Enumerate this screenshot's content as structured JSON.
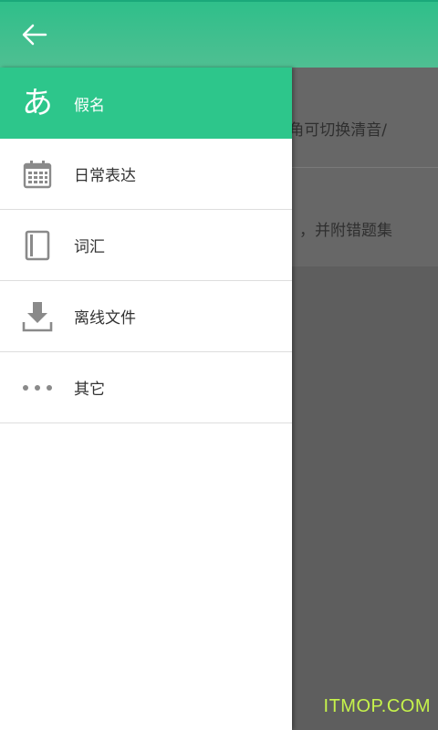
{
  "colors": {
    "accent": "#2dc68b",
    "topbar": "#4fbf92",
    "icon_gray": "#8a8a8a",
    "watermark": "#c6f34b"
  },
  "topbar": {
    "back_icon": "arrow-left-icon"
  },
  "background": {
    "line1": "角可切换清音/",
    "line2": "，并附错题集"
  },
  "drawer": {
    "items": [
      {
        "label": "假名",
        "icon": "あ",
        "icon_name": "kana-icon",
        "active": true
      },
      {
        "label": "日常表达",
        "icon_name": "calendar-icon",
        "active": false
      },
      {
        "label": "词汇",
        "icon_name": "book-icon",
        "active": false
      },
      {
        "label": "离线文件",
        "icon_name": "download-icon",
        "active": false
      },
      {
        "label": "其它",
        "icon_name": "more-icon",
        "active": false
      }
    ]
  },
  "watermark": "ITMOP.COM"
}
